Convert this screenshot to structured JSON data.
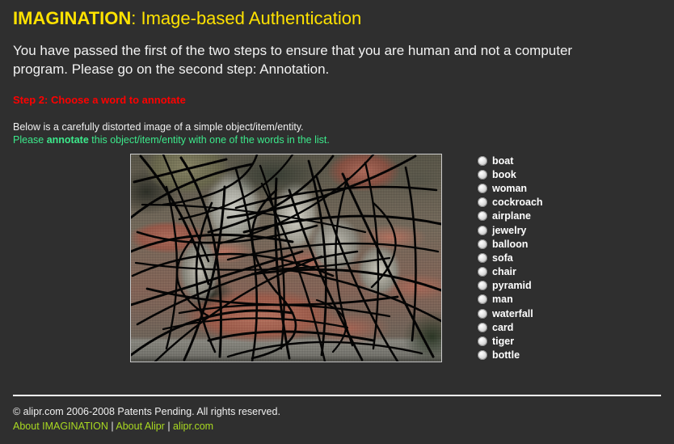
{
  "header": {
    "brand": "IMAGINATION",
    "title_rest": ": Image-based Authentication",
    "brand_color": "#ffe200"
  },
  "intro": {
    "text": "You have passed the first of the two steps to ensure that you are human and not a computer program. Please go on the second step: Annotation."
  },
  "step": {
    "label": "Step 2: Choose a word to annotate",
    "color": "#ff0000"
  },
  "instructions": {
    "line1": "Below is a carefully distorted image of a simple object/item/entity.",
    "line2_prefix": "Please ",
    "line2_emphasis": "annotate",
    "line2_suffix": " this object/item/entity with one of the words in the list.",
    "line2_color": "#3ce98b"
  },
  "captcha": {
    "alt": "distorted-image-of-rooftops-with-scribbles"
  },
  "words": [
    {
      "label": "boat",
      "selected": false
    },
    {
      "label": "book",
      "selected": false
    },
    {
      "label": "woman",
      "selected": false
    },
    {
      "label": "cockroach",
      "selected": false
    },
    {
      "label": "airplane",
      "selected": false
    },
    {
      "label": "jewelry",
      "selected": false
    },
    {
      "label": "balloon",
      "selected": false
    },
    {
      "label": "sofa",
      "selected": false
    },
    {
      "label": "chair",
      "selected": false
    },
    {
      "label": "pyramid",
      "selected": false
    },
    {
      "label": "man",
      "selected": false
    },
    {
      "label": "waterfall",
      "selected": false
    },
    {
      "label": "card",
      "selected": false
    },
    {
      "label": "tiger",
      "selected": false
    },
    {
      "label": "bottle",
      "selected": false
    }
  ],
  "footer": {
    "copyright": "© alipr.com 2006-2008 Patents Pending. All rights reserved.",
    "links": [
      {
        "label": "About IMAGINATION"
      },
      {
        "label": "About Alipr"
      },
      {
        "label": "alipr.com"
      }
    ],
    "separator": "|",
    "link_color": "#a9d921"
  }
}
